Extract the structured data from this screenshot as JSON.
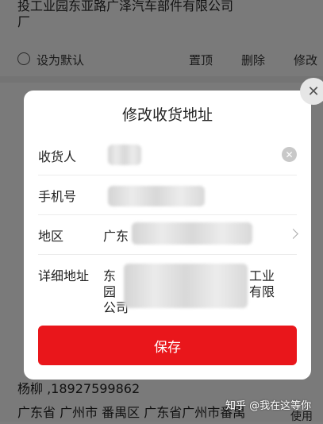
{
  "background": {
    "address_line_1": "投工业园东亚路广泽汽车部件有限公司",
    "address_line_2": "厂",
    "set_default": "设为默认",
    "pin_top": "置顶",
    "delete": "删除",
    "edit": "修改",
    "contact": "杨柳 ,18927599862",
    "address_bottom": "广东省 广州市 番禺区 广东省广州市番禺",
    "use_label": "使用"
  },
  "dialog": {
    "title": "修改收货地址",
    "receiver_label": "收货人",
    "phone_label": "手机号",
    "region_label": "地区",
    "region_value_prefix": "广东",
    "detail_label": "详细地址",
    "detail_line1_prefix": "东",
    "detail_line1_suffix": "工业",
    "detail_line2_prefix": "园",
    "detail_line2_suffix": "有限",
    "detail_line3_prefix": "公司",
    "save_label": "保存"
  },
  "watermark": "知乎 @我在这等你",
  "colors": {
    "accent": "#e9161b"
  }
}
